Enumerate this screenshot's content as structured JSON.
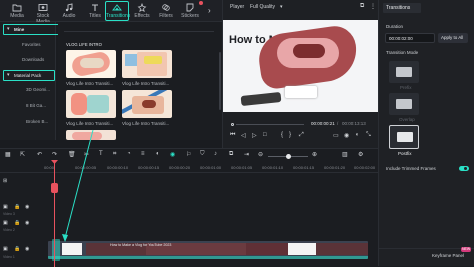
{
  "toolbar": {
    "items": [
      {
        "label": "Media"
      },
      {
        "label": "Stock Media"
      },
      {
        "label": "Audio"
      },
      {
        "label": "Titles"
      },
      {
        "label": "Transitions"
      },
      {
        "label": "Effects"
      },
      {
        "label": "Filters"
      },
      {
        "label": "Stickers"
      }
    ]
  },
  "leftnav": {
    "items": [
      {
        "label": "Mine"
      },
      {
        "label": "Favorites"
      },
      {
        "label": "Downloads"
      },
      {
        "label": "Material Pack"
      },
      {
        "label": "3D Geomi..."
      },
      {
        "label": "8 Bit Ga..."
      },
      {
        "label": "Broken B..."
      }
    ]
  },
  "browser": {
    "section_title": "VLOG LIFE INTRO",
    "cards": [
      {
        "caption": "Vlog Life Intro Transiti..."
      },
      {
        "caption": "Vlog Life Intro Transiti..."
      },
      {
        "caption": "Vlog Life Intro Transiti..."
      },
      {
        "caption": "Vlog Life Intro Transiti..."
      },
      {
        "caption": ""
      }
    ]
  },
  "player": {
    "tab": "Player",
    "quality": "Full Quality",
    "time_current": "00:00:00:21",
    "time_total": "00:00:13:13",
    "video_text": "How to M"
  },
  "props": {
    "tab": "Transitions",
    "duration_label": "Duration",
    "duration_value": "00:00:02:00",
    "apply_all": "Apply to All",
    "mode_label": "Transition Mode",
    "options": [
      {
        "label": "Prefix"
      },
      {
        "label": "Overlap"
      },
      {
        "label": "Postfix"
      }
    ],
    "include_trimmed": "Include Trimmed Frames",
    "keyframe_panel": "Keyframe Panel",
    "new_badge": "NEW"
  },
  "timeline": {
    "ticks": [
      "00:00",
      "00:00:00:05",
      "00:00:00:10",
      "00:00:00:15",
      "00:00:00:20",
      "00:00:01:00",
      "00:00:01:05",
      "00:00:01:10",
      "00:00:01:15",
      "00:00:01:20",
      "00:00:02:00"
    ],
    "tracks": [
      {
        "name": "Video 3"
      },
      {
        "name": "Video 2"
      },
      {
        "name": "Video 1"
      }
    ],
    "clip_title": "How to Make a Vlog for YouTube 2023"
  },
  "colors": {
    "accent": "#2ae0c6",
    "playhead": "#e8525e",
    "clip": "#3b4250"
  }
}
